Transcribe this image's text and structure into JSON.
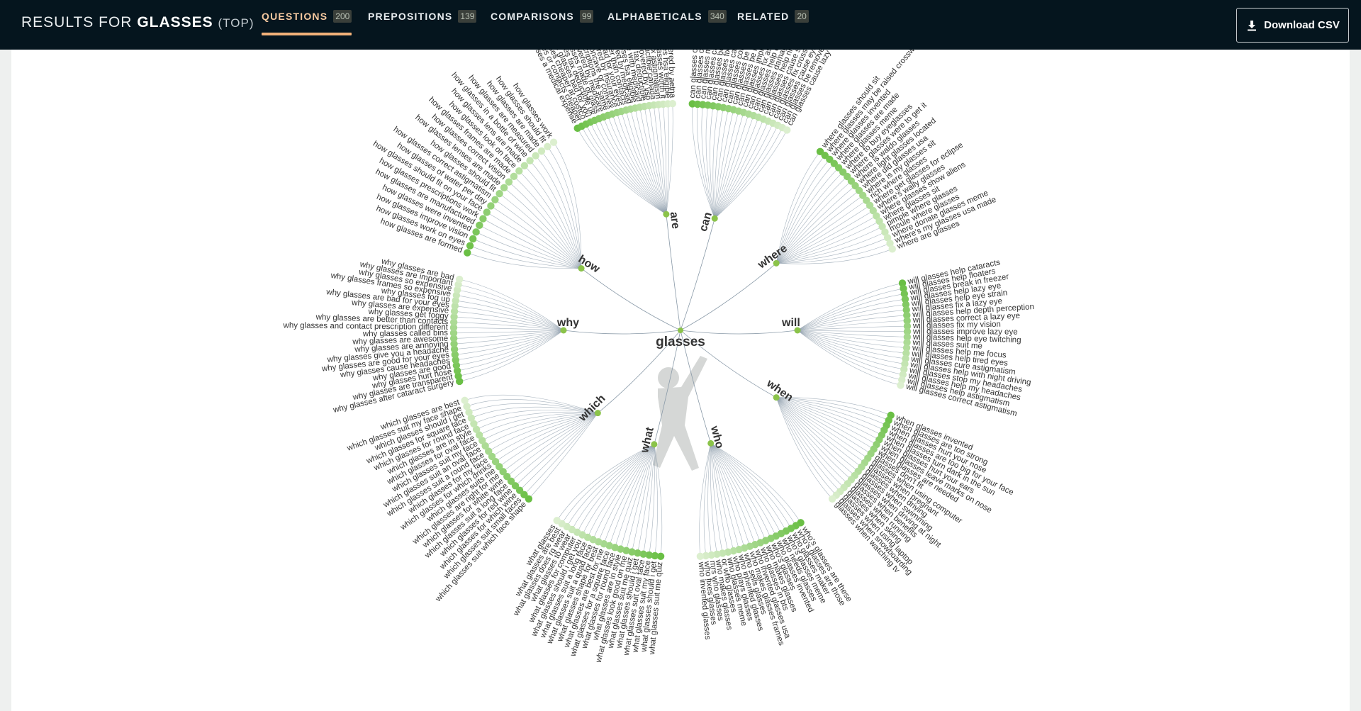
{
  "header": {
    "results_prefix": "RESULTS FOR",
    "keyword": "GLASSES",
    "sort": "(TOP)"
  },
  "tabs": [
    {
      "label": "QUESTIONS",
      "count": "200",
      "active": true
    },
    {
      "label": "PREPOSITIONS",
      "count": "139",
      "active": false
    },
    {
      "label": "COMPARISONS",
      "count": "99",
      "active": false
    },
    {
      "label": "ALPHABETICALS",
      "count": "340",
      "active": false
    },
    {
      "label": "RELATED",
      "count": "20",
      "active": false
    }
  ],
  "download_label": "Download CSV",
  "colors": {
    "header_bg": "#05151e",
    "accent": "#f2b179",
    "node_green": "#8bc34a",
    "leaf_dark": "#6abf45",
    "leaf_light": "#dcefcf",
    "link": "#8a9aa8"
  },
  "icons": {
    "download": "download-icon",
    "center": "person-silhouette"
  },
  "wheel": {
    "center_label": "glasses",
    "branches": [
      {
        "label": "are",
        "leaves": [
          "are glasses a medical expense",
          "are glasses or contacts cheaper",
          "are glasses cheaper at costco",
          "are glasses bad for you",
          "are glasses tax deductible uk",
          "are glasses made of glass",
          "are glasses covered by medicare",
          "are glasses and contact prescriptions the same",
          "are glasses concave or convex",
          "are glasses covered by insurance",
          "are glasses bad for your eyes",
          "are glasses better than contacts",
          "are glasses covered by medicaid",
          "are glasses fsa eligible",
          "are glasses free with medicaid",
          "are glasses tax deductible",
          "are glasses covered by vsp",
          "are glasses tax deductible canada",
          "are glasses fix astigmatism",
          "are glasses worth it",
          "are glasses hsa eligible",
          "are glasses covered by aetna"
        ]
      },
      {
        "label": "can",
        "leaves": [
          "can glasses cause headaches",
          "can glasses cause vertigo",
          "can glasses make you dizzy",
          "can glasses cause acne",
          "can glasses be recycled",
          "can glasses fix lazy eye",
          "can glasses cause migraines",
          "can glasses correct double vision",
          "can glasses be repaired",
          "can glasses be returned",
          "can glasses improve vision",
          "can glasses fix astigmatism",
          "can glasses help dry eyes",
          "can glasses damage your vision",
          "can glasses help night vision",
          "can glasses cause skin cancer",
          "can glasses fix cross eye",
          "can glasses cause eye strain",
          "can glasses be removed",
          "can glasses cause lazy eye"
        ]
      },
      {
        "label": "where",
        "leaves": [
          "where glasses should sit",
          "where glasses may be raised crossword",
          "where glasses invented",
          "where glasses are made",
          "where glasses meme",
          "where to buy eyeglasses",
          "where glasses were to get it",
          "where is waldo glasses",
          "where light glasses located",
          "where did glasses usa",
          "where is my glasses sit",
          "rich where glasses",
          "where get glasses for eclipse",
          "where's wally glasses",
          "where glasses show aliens",
          "where glasses sit",
          "pimple where glasses",
          "moule where glasses",
          "where donate glasses meme",
          "where's my glasses usa made",
          "where are glasses"
        ]
      },
      {
        "label": "will",
        "leaves": [
          "will glasses help cataracts",
          "will glasses help floaters",
          "will glasses break in freezer",
          "will glasses help lazy eye",
          "will glasses help eye strain",
          "will glasses fix a lazy eye",
          "will glasses help depth perception",
          "will glasses correct a lazy eye",
          "will glasses fix my vision",
          "will glasses improve lazy eye",
          "will glasses help eye twitching",
          "will glasses suit me",
          "will glasses help me focus",
          "will glasses help tired eyes",
          "will glasses cure astigmatism",
          "will glasses help with night driving",
          "will glasses stop my headaches",
          "will glasses help my headaches",
          "will glasses help astigmatism",
          "will glasses correct astigmatism"
        ]
      },
      {
        "label": "when",
        "leaves": [
          "when glasses invented",
          "when glasses are too strong",
          "when glasses hurt your nose",
          "when glasses are too big for your face",
          "when glasses turn dark in the sun",
          "when glasses hurt your ears",
          "when glasses leave marks on nose",
          "when glasses are needed",
          "glasses don't fit",
          "glasses when using computer",
          "glasses when pregnant",
          "glasses when driving",
          "glasses when swimming",
          "glasses when driving at night",
          "glasses when benefits",
          "glasses when running",
          "glasses when skiing",
          "glasses when using laptop",
          "glasses when snowboarding",
          "glasses when watching tv"
        ]
      },
      {
        "label": "who",
        "leaves": [
          "who's glasses are these",
          "who's glasses are those",
          "who glasses maker",
          "who's glasses meme",
          "who needs glasses",
          "who glasses invented",
          "who's glasses",
          "who makes glasses",
          "who glasses in bts",
          "who invented glasses usa",
          "who makes glasses frames",
          "who sells glasses",
          "who inherited glasses",
          "who plays glasses",
          "who glasses meme",
          "or who glasses",
          "who makes glasses",
          "mrs who glasses",
          "who fixes glasses",
          "who invented glasses"
        ]
      },
      {
        "label": "what",
        "leaves": [
          "what glasses suit me quiz",
          "what glasses should i get",
          "what glasses suit my face",
          "what glasses suit oval face",
          "what glasses should i get",
          "what glasses suit me quiz",
          "what glasses look good on me",
          "what glasses are in style",
          "what glasses for round face",
          "what glasses for a square face",
          "what glasses are best for me",
          "what glasses shape for best",
          "what glasses suit a quad face",
          "what glasses suit a long face",
          "what glasses should i get you",
          "what glasses for computer",
          "what glasses to wear",
          "what glasses does rg wear",
          "what glasses are best",
          "what glasses"
        ]
      },
      {
        "label": "which",
        "leaves": [
          "which glasses suit which face shape",
          "which glasses suit small faces",
          "which glasses for which wine",
          "which glasses for red wine",
          "which glasses suit a long face",
          "which glasses for white wine",
          "which glasses are right for me",
          "which glasses suits me",
          "which glasses for which drinks",
          "which glasses for my face",
          "which glasses suit a round face",
          "which glasses suit an oval face",
          "which glasses suit my face",
          "which glasses for oval face",
          "which glasses are in style",
          "which glasses for round face",
          "which glasses for square face",
          "which glasses should i get",
          "which glasses suit my face shape",
          "which glasses are best"
        ]
      },
      {
        "label": "why",
        "leaves": [
          "why glasses after cataract surgery",
          "why glasses are transparent",
          "why glasses hurt nose",
          "why glasses are good",
          "why glasses cause headaches",
          "why glasses are good for your eyes",
          "why glasses give you a headache",
          "why glasses are annoying",
          "why glasses are awesome",
          "why glasses called bins",
          "why glasses and contact prescription different",
          "why glasses are better than contacts",
          "why glasses get foggy",
          "why glasses are expensive",
          "why glasses are bad for your eyes",
          "why glasses fog up",
          "why glasses frames so expensive",
          "why glasses so expensive",
          "why glasses are important",
          "why glasses are bad"
        ]
      },
      {
        "label": "how",
        "leaves": [
          "how glasses are formed",
          "how glasses work on eyes",
          "how glasses improve vision",
          "how glasses were invented",
          "how glasses are manufactured",
          "how glasses prescriptions work",
          "how glasses should fit on your face",
          "how glasses of water per day",
          "how glasses correct astigmatism",
          "how glasses should fit",
          "how glasses lenses are made",
          "how glasses correct vision",
          "how glasses frames are made",
          "how glasses look on face",
          "how glasses lens are made",
          "how glasses in a bottle of wine",
          "how glasses are measured",
          "how glasses are made",
          "how glasses should fit",
          "how glasses work"
        ]
      }
    ]
  }
}
